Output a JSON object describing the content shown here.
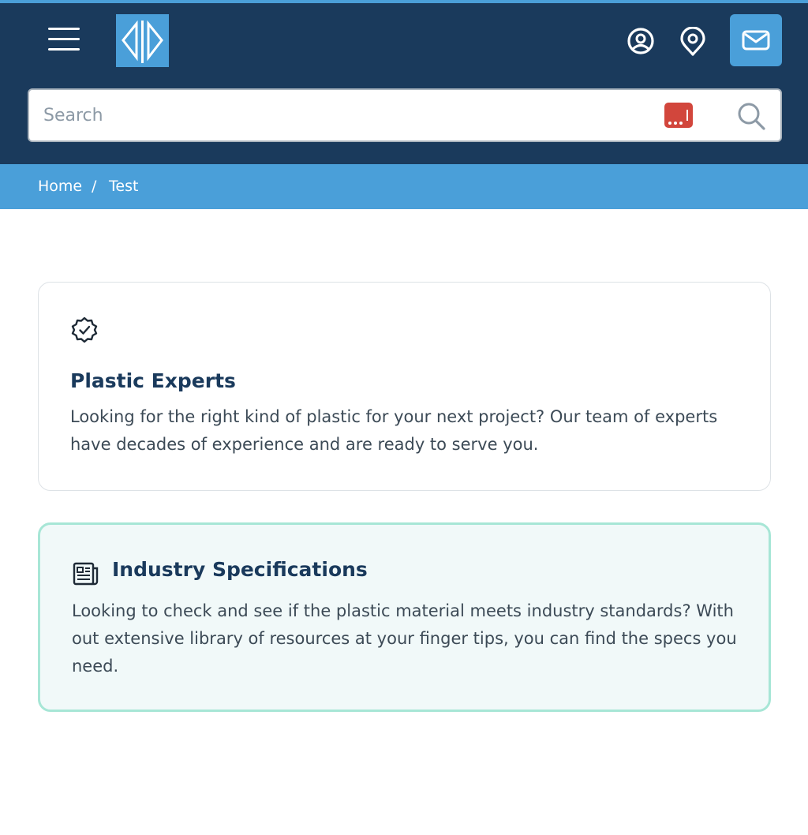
{
  "header": {
    "menu_icon": "hamburger-menu-icon",
    "logo_icon": "brand-logo",
    "account_icon": "user-circle-icon",
    "location_icon": "map-pin-icon",
    "mail_icon": "mail-icon",
    "colors": {
      "header_bg": "#1a3a5c",
      "accent": "#4a9fd9"
    }
  },
  "search": {
    "placeholder": "Search",
    "value": "",
    "password_manager_icon": "password-manager-icon",
    "search_icon": "search-icon"
  },
  "breadcrumb": {
    "items": [
      "Home",
      "Test"
    ],
    "separator": "/"
  },
  "cards": [
    {
      "icon": "badge-check-icon",
      "title": "Plastic Experts",
      "text": "Looking for the right kind of plastic for your next project? Our team of experts have decades of experience and are ready to serve you."
    },
    {
      "icon": "newspaper-icon",
      "title": "Industry Specifications",
      "text": "Looking to check and see if the plastic material meets industry standards? With out extensive library of resources at your finger tips, you can find the specs you need."
    }
  ]
}
